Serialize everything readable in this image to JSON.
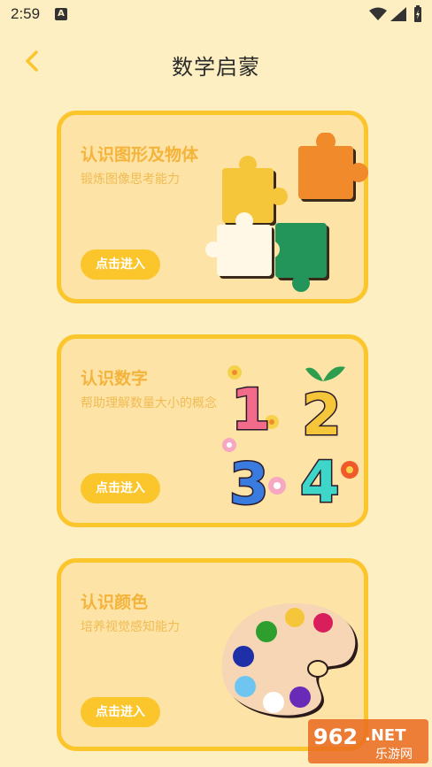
{
  "status": {
    "time": "2:59"
  },
  "header": {
    "title": "数学启蒙"
  },
  "cards": [
    {
      "title": "认识图形及物体",
      "subtitle": "锻炼图像思考能力",
      "button": "点击进入",
      "illustration": "puzzle-pieces"
    },
    {
      "title": "认识数字",
      "subtitle": "帮助理解数量大小的概念",
      "button": "点击进入",
      "illustration": "numbers-1234",
      "digits": [
        "1",
        "2",
        "3",
        "4"
      ]
    },
    {
      "title": "认识颜色",
      "subtitle": "培养视觉感知能力",
      "button": "点击进入",
      "illustration": "paint-palette"
    }
  ],
  "watermark": {
    "number": "962",
    "net": ".NET",
    "text": "乐游网"
  },
  "colors": {
    "background": "#FDEFC2",
    "card_border": "#FBC52C",
    "card_fill": "#FDE3A6",
    "accent_text": "#F4B33A"
  }
}
